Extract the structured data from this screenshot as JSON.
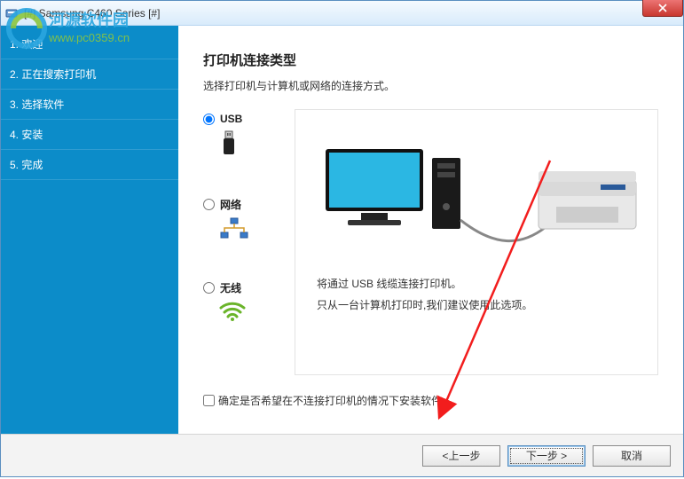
{
  "window": {
    "title": "[#] Samsung C460 Series [#]"
  },
  "watermark": {
    "line1": "河源软件园",
    "line2": "www.pc0359.cn"
  },
  "sidebar": {
    "items": [
      {
        "label": "1. 欢迎"
      },
      {
        "label": "2. 正在搜索打印机"
      },
      {
        "label": "3. 选择软件"
      },
      {
        "label": "4. 安装"
      },
      {
        "label": "5. 完成"
      }
    ]
  },
  "page": {
    "title": "打印机连接类型",
    "subtitle": "选择打印机与计算机或网络的连接方式。"
  },
  "options": {
    "usb": {
      "label": "USB",
      "selected": true
    },
    "network": {
      "label": "网络",
      "selected": false
    },
    "wireless": {
      "label": "无线",
      "selected": false
    }
  },
  "detail": {
    "line1": "将通过 USB 线缆连接打印机。",
    "line2": "只从一台计算机打印时,我们建议使用此选项。"
  },
  "checkbox": {
    "label": "确定是否希望在不连接打印机的情况下安装软件。",
    "checked": false
  },
  "buttons": {
    "back": "<上一步",
    "next": "下一步 >",
    "cancel": "取消"
  }
}
